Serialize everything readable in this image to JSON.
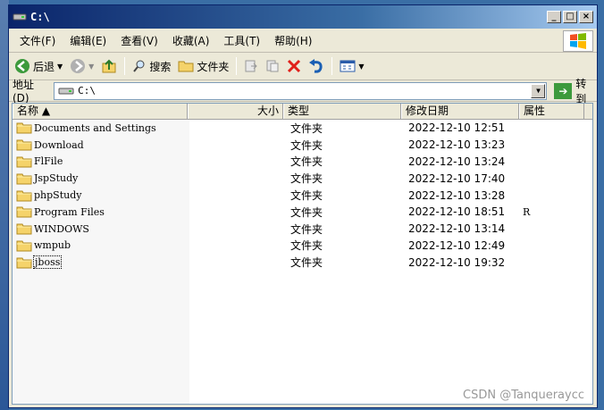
{
  "window": {
    "title": "C:\\"
  },
  "title_buttons": {
    "minimize": "_",
    "maximize": "□",
    "close": "×"
  },
  "menu": [
    {
      "label": "文件(F)"
    },
    {
      "label": "编辑(E)"
    },
    {
      "label": "查看(V)"
    },
    {
      "label": "收藏(A)"
    },
    {
      "label": "工具(T)"
    },
    {
      "label": "帮助(H)"
    }
  ],
  "toolbar": {
    "back_label": "后退",
    "search_label": "搜索",
    "folders_label": "文件夹"
  },
  "address": {
    "label": "地址(D)",
    "value": "C:\\",
    "go_label": "转到"
  },
  "columns": {
    "name": "名称 ▲",
    "size": "大小",
    "type": "类型",
    "date": "修改日期",
    "attr": "属性"
  },
  "files": [
    {
      "name": "Documents and Settings",
      "type": "文件夹",
      "date": "2022-12-10 12:51",
      "attr": ""
    },
    {
      "name": "Download",
      "type": "文件夹",
      "date": "2022-12-10 13:23",
      "attr": ""
    },
    {
      "name": "FlFile",
      "type": "文件夹",
      "date": "2022-12-10 13:24",
      "attr": ""
    },
    {
      "name": "JspStudy",
      "type": "文件夹",
      "date": "2022-12-10 17:40",
      "attr": ""
    },
    {
      "name": "phpStudy",
      "type": "文件夹",
      "date": "2022-12-10 13:28",
      "attr": ""
    },
    {
      "name": "Program Files",
      "type": "文件夹",
      "date": "2022-12-10 18:51",
      "attr": "R"
    },
    {
      "name": "WINDOWS",
      "type": "文件夹",
      "date": "2022-12-10 13:14",
      "attr": ""
    },
    {
      "name": "wmpub",
      "type": "文件夹",
      "date": "2022-12-10 12:49",
      "attr": ""
    },
    {
      "name": "jboss",
      "type": "文件夹",
      "date": "2022-12-10 19:32",
      "attr": ""
    }
  ],
  "watermark": "CSDN @Tanqueraycc",
  "colors": {
    "titlebar": "#0a246a",
    "window_bg": "#ece9d8",
    "folder": "#f5d36a"
  }
}
